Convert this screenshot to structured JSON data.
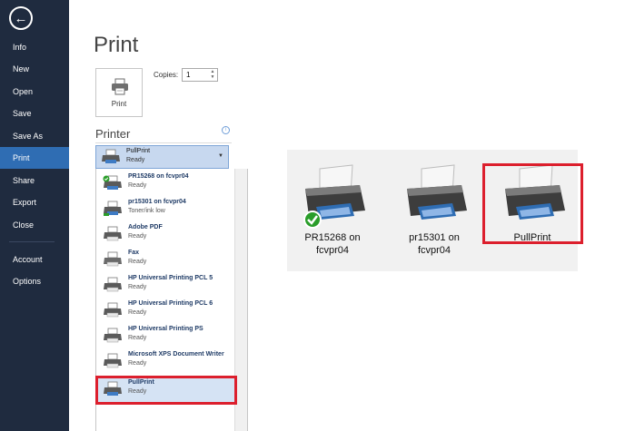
{
  "nav": {
    "back_icon": "back-arrow-icon",
    "items": [
      {
        "label": "Info"
      },
      {
        "label": "New"
      },
      {
        "label": "Open"
      },
      {
        "label": "Save"
      },
      {
        "label": "Save As"
      },
      {
        "label": "Print"
      },
      {
        "label": "Share"
      },
      {
        "label": "Export"
      },
      {
        "label": "Close"
      },
      {
        "label": "Account"
      },
      {
        "label": "Options"
      }
    ]
  },
  "main": {
    "title": "Print",
    "print_button_label": "Print",
    "copies_label": "Copies:",
    "copies_value": "1",
    "printer_section_title": "Printer",
    "selected_printer": {
      "name": "PullPrint",
      "status": "Ready"
    },
    "printers": [
      {
        "name": "PR15268 on fcvpr04",
        "status": "Ready",
        "default": true
      },
      {
        "name": "pr15301 on fcvpr04",
        "status": "Toner/ink low"
      },
      {
        "name": "Adobe PDF",
        "status": "Ready"
      },
      {
        "name": "Fax",
        "status": "Ready"
      },
      {
        "name": "HP Universal Printing PCL 5",
        "status": "Ready"
      },
      {
        "name": "HP Universal Printing PCL 6",
        "status": "Ready"
      },
      {
        "name": "HP Universal Printing PS",
        "status": "Ready"
      },
      {
        "name": "Microsoft XPS Document Writer",
        "status": "Ready"
      },
      {
        "name": "PullPrint",
        "status": "Ready"
      }
    ]
  },
  "devices_panel": {
    "printers": [
      {
        "label_line1": "PR15268 on",
        "label_line2": "fcvpr04",
        "default": true
      },
      {
        "label_line1": "pr15301 on",
        "label_line2": "fcvpr04"
      },
      {
        "label_line1": "PullPrint",
        "label_line2": ""
      }
    ]
  },
  "colors": {
    "sidebar_bg": "#1f2b3f",
    "sidebar_active": "#2f6db3",
    "highlight_red": "#dc1f2d",
    "selection_blue": "#c7d8ef"
  }
}
